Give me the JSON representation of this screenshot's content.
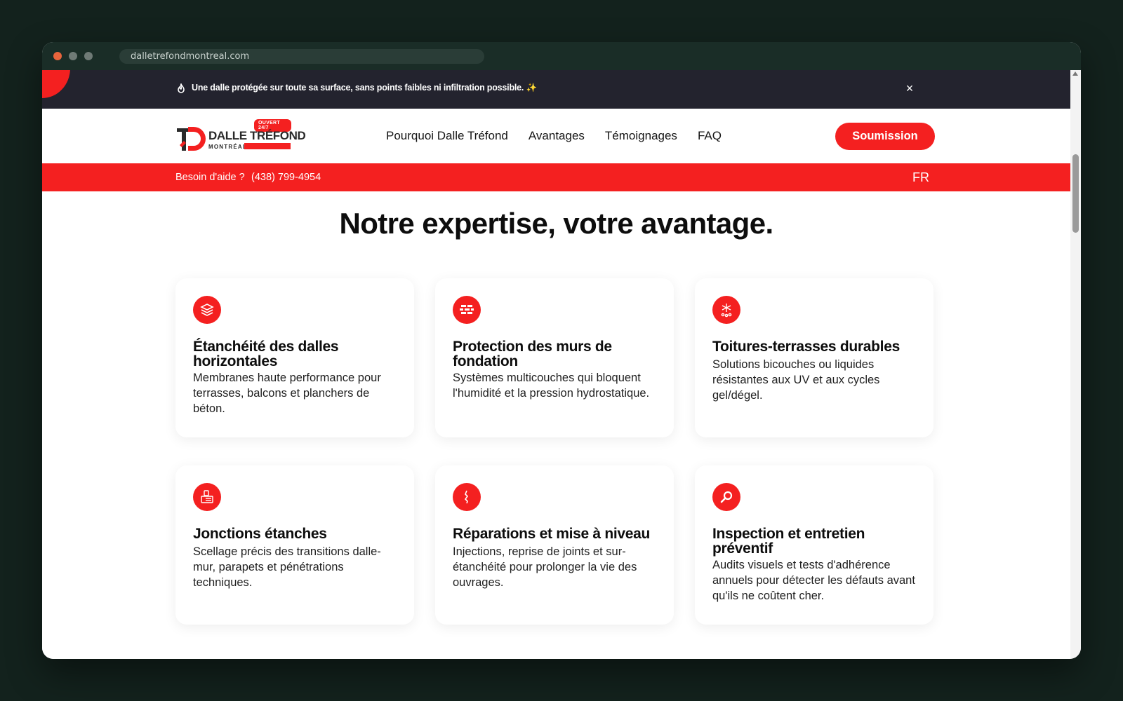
{
  "browser": {
    "url": "dalletrefondmontreal.com"
  },
  "announcement": {
    "text": "Une dalle protégée sur toute sa surface, sans points faibles ni infiltration possible. ✨",
    "close_symbol": "×"
  },
  "logo": {
    "badge": "OUVERT 24/7",
    "name": "DALLE TRÉFOND",
    "city": "MONTRÉAL"
  },
  "nav": {
    "links": [
      "Pourquoi Dalle Tréfond",
      "Avantages",
      "Témoignages",
      "FAQ"
    ],
    "cta": "Soumission"
  },
  "helpbar": {
    "label": "Besoin d'aide ?",
    "phone": "(438) 799-4954",
    "language": "FR"
  },
  "section": {
    "title": "Notre expertise, votre avantage.",
    "cards": [
      {
        "icon": "layers-icon",
        "title": "Étanchéité des dalles horizontales",
        "desc": "Membranes haute performance pour terrasses, balcons et planchers de béton."
      },
      {
        "icon": "brick-wall-icon",
        "title": "Protection des murs de fondation",
        "desc": "Systèmes multicouches qui bloquent l'humidité et la pression hydrostatique."
      },
      {
        "icon": "snowflake-icon",
        "title": "Toitures-terrasses durables",
        "desc": "Solutions bicouches ou liquides résistantes aux UV et aux cycles gel/dégel."
      },
      {
        "icon": "sealant-icon",
        "title": "Jonctions étanches",
        "desc": "Scellage précis des transitions dalle-mur, parapets et pénétrations techniques."
      },
      {
        "icon": "crack-icon",
        "title": "Réparations et mise à niveau",
        "desc": "Injections, reprise de joints et sur-étanchéité pour prolonger la vie des ouvrages."
      },
      {
        "icon": "magnifier-icon",
        "title": "Inspection et entretien préventif",
        "desc": "Audits visuels et tests d'adhérence annuels pour détecter les défauts avant qu'ils ne coûtent cher."
      }
    ]
  },
  "colors": {
    "accent": "#f42020",
    "announcement_bg": "#23232e",
    "page_bg": "#13221d"
  }
}
